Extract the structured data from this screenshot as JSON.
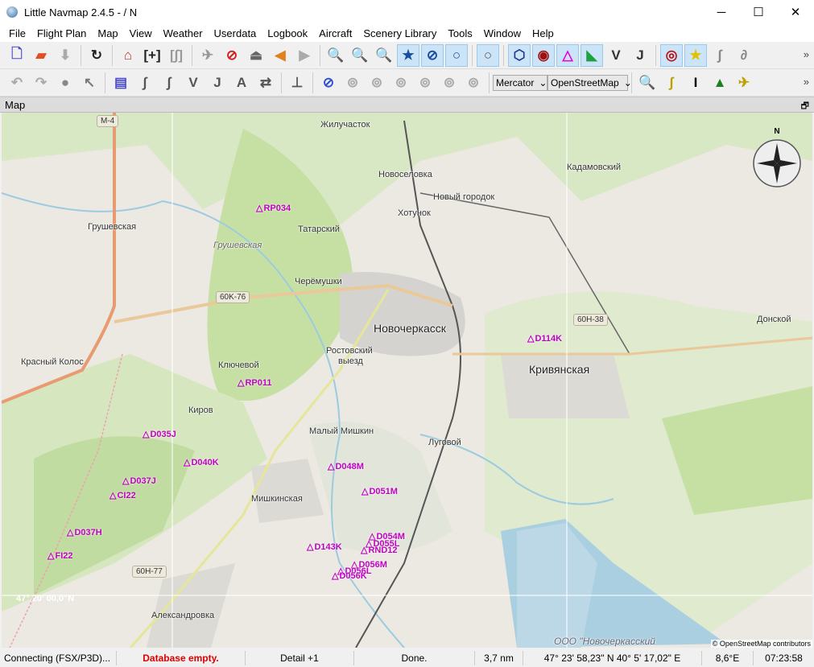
{
  "window": {
    "title": "Little Navmap 2.4.5 -  / N",
    "minimize": "─",
    "maximize": "☐",
    "close": "✕"
  },
  "menu": [
    "File",
    "Flight Plan",
    "Map",
    "View",
    "Weather",
    "Userdata",
    "Logbook",
    "Aircraft",
    "Scenery Library",
    "Tools",
    "Window",
    "Help"
  ],
  "toolbar1": [
    {
      "n": "new-flightplan",
      "g": "🗋",
      "c": "#4a4acc"
    },
    {
      "n": "open-flightplan",
      "g": "▰",
      "c": "#e05020"
    },
    {
      "n": "save-flightplan",
      "g": "⬇",
      "c": "#aaa"
    },
    "|",
    {
      "n": "reload",
      "g": "↻",
      "c": "#222"
    },
    "|",
    {
      "n": "home",
      "g": "⌂",
      "c": "#c03020"
    },
    {
      "n": "add-position",
      "g": "[+]",
      "c": "#222"
    },
    {
      "n": "flightplan-range",
      "g": "[∫]",
      "c": "#999"
    },
    "|",
    {
      "n": "center-aircraft",
      "g": "✈",
      "c": "#999"
    },
    {
      "n": "no-aircraft",
      "g": "⊘",
      "c": "#d02020"
    },
    {
      "n": "erase-trail",
      "g": "⏏",
      "c": "#666"
    },
    {
      "n": "back",
      "g": "◀",
      "c": "#e08020"
    },
    {
      "n": "forward",
      "g": "▶",
      "c": "#aaa"
    },
    "|",
    {
      "n": "zoom-in",
      "g": "🔍",
      "c": "#c00"
    },
    {
      "n": "zoom-out",
      "g": "🔍",
      "c": "#333"
    },
    {
      "n": "zoom-fit",
      "g": "🔍",
      "c": "#1a4da0"
    },
    {
      "n": "airports",
      "g": "★",
      "c": "#1a4da0",
      "a": true
    },
    {
      "n": "soft-airports",
      "g": "⊘",
      "c": "#1a4da0",
      "a": true
    },
    {
      "n": "empty-airports",
      "g": "○",
      "c": "#1a4da0",
      "a": true
    },
    "|",
    {
      "n": "addon-airports",
      "g": "○",
      "c": "#555",
      "a": true
    },
    "|",
    {
      "n": "vor",
      "g": "⬡",
      "c": "#1a3a90",
      "a": true
    },
    {
      "n": "ndb",
      "g": "◉",
      "c": "#a01010",
      "a": true
    },
    {
      "n": "waypoint",
      "g": "△",
      "c": "#e000e0",
      "a": true
    },
    {
      "n": "ils",
      "g": "◣",
      "c": "#20a040",
      "a": true
    },
    {
      "n": "victor-airways",
      "g": "V",
      "c": "#333"
    },
    {
      "n": "jet-airways",
      "g": "J",
      "c": "#333"
    },
    "|",
    {
      "n": "user-aircraft",
      "g": "◎",
      "c": "#c01010",
      "a": true
    },
    {
      "n": "userpoints",
      "g": "★",
      "c": "#e0c000",
      "a": true
    },
    {
      "n": "procedures",
      "g": "∫",
      "c": "#888"
    },
    {
      "n": "missed",
      "g": "∂",
      "c": "#888"
    }
  ],
  "toolbar2": [
    {
      "n": "undo",
      "g": "↶",
      "c": "#aaa"
    },
    {
      "n": "redo",
      "g": "↷",
      "c": "#aaa"
    },
    {
      "n": "measure",
      "g": "●",
      "c": "#888"
    },
    {
      "n": "select",
      "g": "↖",
      "c": "#777"
    },
    "|",
    {
      "n": "route-add",
      "g": "▤",
      "c": "#4a4acc"
    },
    {
      "n": "route-edit",
      "g": "∫",
      "c": "#555"
    },
    {
      "n": "route-departure",
      "g": "∫",
      "c": "#555"
    },
    {
      "n": "route-v",
      "g": "V",
      "c": "#555"
    },
    {
      "n": "route-j",
      "g": "J",
      "c": "#555"
    },
    {
      "n": "route-a",
      "g": "A",
      "c": "#555"
    },
    {
      "n": "route-reverse",
      "g": "⇄",
      "c": "#555"
    },
    "|",
    {
      "n": "route-insert",
      "g": "⊥",
      "c": "#555"
    },
    "|",
    {
      "n": "airspace-all",
      "g": "⊘",
      "c": "#3050d0"
    },
    {
      "n": "airspace-icao",
      "g": "⊚",
      "c": "#aaa"
    },
    {
      "n": "airspace-fir",
      "g": "⊚",
      "c": "#aaa"
    },
    {
      "n": "airspace-rstr",
      "g": "⊚",
      "c": "#aaa"
    },
    {
      "n": "airspace-spec",
      "g": "⊚",
      "c": "#aaa"
    },
    {
      "n": "airspace-other",
      "g": "⊚",
      "c": "#aaa"
    },
    {
      "n": "airspace-altitude",
      "g": "⊚",
      "c": "#aaa"
    }
  ],
  "toolbar2_combos": {
    "projection": "Mercator",
    "theme": "OpenStreetMap"
  },
  "toolbar2_right": [
    {
      "n": "search-window",
      "g": "🔍",
      "c": "#333"
    },
    {
      "n": "flightplan-window",
      "g": "∫",
      "c": "#c0a000"
    },
    {
      "n": "info-window",
      "g": "I",
      "c": "#000"
    },
    {
      "n": "profile-window",
      "g": "▲",
      "c": "#208020"
    },
    {
      "n": "aircraft-window",
      "g": "✈",
      "c": "#c0a000"
    }
  ],
  "more": "»",
  "dock": {
    "title": "Map",
    "float": "🗗"
  },
  "map": {
    "towns": [
      "Жилучасток",
      "Новоселовка",
      "Новый городок",
      "Хотунок",
      "Кадамовский",
      "Грушевская",
      "Грушевская",
      "Татарский",
      "Черёмушки",
      "Новочеркасск",
      "Ростовский",
      "выезд",
      "Красный Колос",
      "Ключевой",
      "Кривянская",
      "Донской",
      "Киров",
      "Малый Мишкин",
      "Луговой",
      "Мишкинская",
      "Александровка"
    ],
    "roads": [
      "M-4",
      "60K-76",
      "60H-38",
      "60H-77"
    ],
    "waypoints": [
      "RP034",
      "RP011",
      "D035J",
      "D040K",
      "D037J",
      "CI22",
      "D037H",
      "FI22",
      "D048M",
      "D051M",
      "D114K",
      "D054M",
      "D055L",
      "RND12",
      "D143K",
      "D056M",
      "D056L",
      "D056K"
    ],
    "grid_label": "47° 20' 00,0\"N",
    "compass_n": "N",
    "credit": "© OpenStreetMap contributors",
    "watermark": "ООО \"Новочеркасский"
  },
  "status": {
    "connection": "Connecting (FSX/P3D)...",
    "database": "Database empty.",
    "detail": "Detail +1",
    "state": "Done.",
    "distance": "3,7 nm",
    "position": "47° 23' 58,23\" N 40° 5' 17,02\" E",
    "magvar": "8,6°E",
    "time": "07:23:58"
  },
  "colors": {
    "waypoint": "#c000c0",
    "error": "#e00000",
    "active_button": "#cce4f7"
  }
}
